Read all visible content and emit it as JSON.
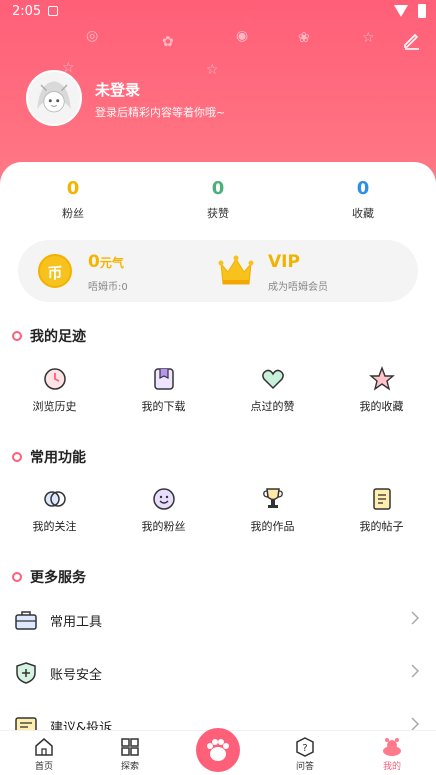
{
  "status_bar": {
    "time": "2:05"
  },
  "profile": {
    "title": "未登录",
    "subtitle": "登录后精彩内容等着你哦~"
  },
  "stats": [
    {
      "value": "0",
      "label": "粉丝",
      "color": "#f4b400"
    },
    {
      "value": "0",
      "label": "获赞",
      "color": "#4caf7d"
    },
    {
      "value": "0",
      "label": "收藏",
      "color": "#2f8ee6"
    }
  ],
  "wallet": {
    "coin_glyph": "币",
    "amount": "0",
    "amount_unit": "元气",
    "coin_label": "唔姆币:0",
    "vip_title": "VIP",
    "vip_subtitle": "成为唔姆会员"
  },
  "footprints": {
    "title": "我的足迹",
    "items": [
      {
        "label": "浏览历史",
        "icon": "history-icon"
      },
      {
        "label": "我的下载",
        "icon": "download-icon"
      },
      {
        "label": "点过的赞",
        "icon": "heart-icon"
      },
      {
        "label": "我的收藏",
        "icon": "star-icon"
      }
    ]
  },
  "functions": {
    "title": "常用功能",
    "items": [
      {
        "label": "我的关注",
        "icon": "follow-icon"
      },
      {
        "label": "我的粉丝",
        "icon": "fans-icon"
      },
      {
        "label": "我的作品",
        "icon": "trophy-icon"
      },
      {
        "label": "我的帖子",
        "icon": "post-icon"
      }
    ]
  },
  "services": {
    "title": "更多服务",
    "rows": [
      {
        "label": "常用工具",
        "icon": "toolbox-icon"
      },
      {
        "label": "账号安全",
        "icon": "shield-icon"
      },
      {
        "label": "建议&投诉",
        "icon": "feedback-icon"
      }
    ]
  },
  "nav": {
    "items": [
      {
        "label": "首页",
        "icon": "home-icon"
      },
      {
        "label": "探索",
        "icon": "explore-icon"
      },
      {
        "label": "",
        "icon": "paw-icon"
      },
      {
        "label": "问答",
        "icon": "question-icon"
      },
      {
        "label": "我的",
        "icon": "profile-icon",
        "active": true
      }
    ]
  },
  "colors": {
    "accent": "#ff5f78",
    "gold": "#f4b400"
  }
}
